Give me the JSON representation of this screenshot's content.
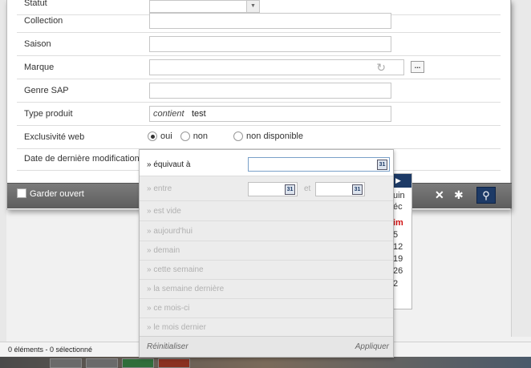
{
  "form": {
    "statut_label": "Statut",
    "collection_label": "Collection",
    "saison_label": "Saison",
    "marque_label": "Marque",
    "genre_label": "Genre SAP",
    "type_label": "Type produit",
    "type_operator": "contient",
    "type_value": "test",
    "exclu_label": "Exclusivité web",
    "exclu_options": [
      "oui",
      "non",
      "non disponible"
    ],
    "exclu_selected": "oui",
    "date_label": "Date de dernière modification",
    "dots_label": "..."
  },
  "footer": {
    "garder_label": "Garder ouvert"
  },
  "date_popup": {
    "options": [
      "» équivaut à",
      "» entre",
      "» est vide",
      "» aujourd'hui",
      "» demain",
      "» cette semaine",
      "» la semaine dernière",
      "» ce mois-ci",
      "» le mois dernier"
    ],
    "active": "» équivaut à",
    "between_sep": "et",
    "cal_icon_text": "31",
    "reset_label": "Réinitialiser",
    "apply_label": "Appliquer"
  },
  "calendar_fragment": {
    "rows": [
      "uin",
      "éc",
      "im",
      "5",
      "12",
      "19",
      "26",
      "2"
    ]
  },
  "status": {
    "text": "0 éléments - 0 sélectionné"
  },
  "icons": {
    "refresh": "refresh-icon",
    "clear_filter": "clear-filter-icon",
    "config": "config-icon",
    "search": "search-icon"
  }
}
